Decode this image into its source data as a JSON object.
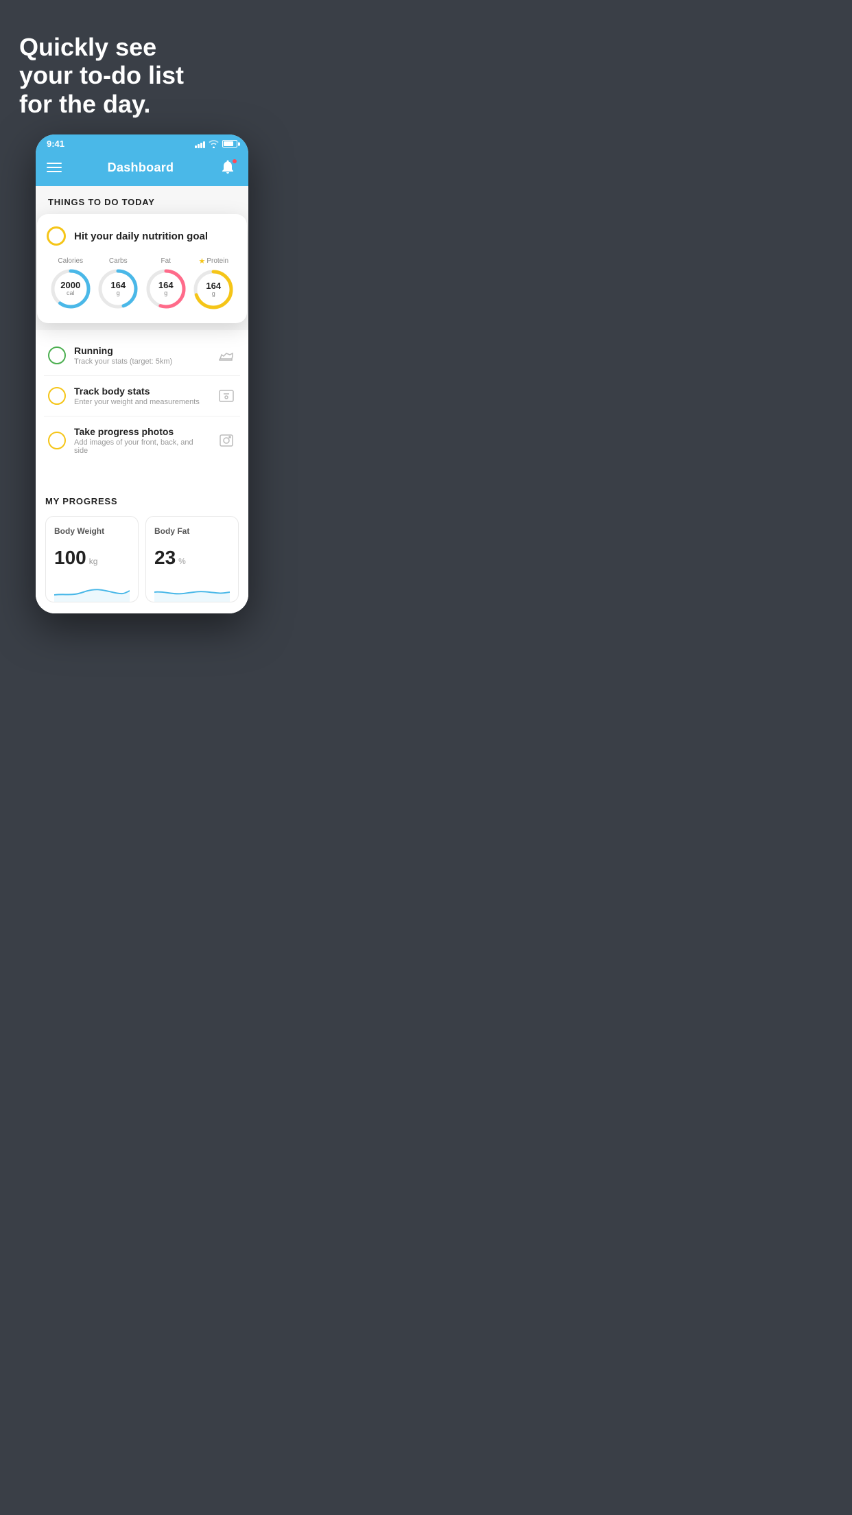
{
  "background": {
    "headline": "Quickly see\nyour to-do list\nfor the day."
  },
  "statusBar": {
    "time": "9:41"
  },
  "header": {
    "title": "Dashboard"
  },
  "thingsToday": {
    "sectionTitle": "THINGS TO DO TODAY"
  },
  "nutritionCard": {
    "title": "Hit your daily nutrition goal",
    "items": [
      {
        "label": "Calories",
        "value": "2000",
        "unit": "cal",
        "color": "#4ab8e8",
        "percent": 60
      },
      {
        "label": "Carbs",
        "value": "164",
        "unit": "g",
        "color": "#4ab8e8",
        "percent": 45
      },
      {
        "label": "Fat",
        "value": "164",
        "unit": "g",
        "color": "#ff6b8a",
        "percent": 55
      },
      {
        "label": "Protein",
        "value": "164",
        "unit": "g",
        "color": "#f5c518",
        "percent": 70,
        "starred": true
      }
    ]
  },
  "todoItems": [
    {
      "title": "Running",
      "subtitle": "Track your stats (target: 5km)",
      "circleColor": "green",
      "icon": "shoe-icon"
    },
    {
      "title": "Track body stats",
      "subtitle": "Enter your weight and measurements",
      "circleColor": "yellow",
      "icon": "scale-icon"
    },
    {
      "title": "Take progress photos",
      "subtitle": "Add images of your front, back, and side",
      "circleColor": "yellow",
      "icon": "photo-icon"
    }
  ],
  "progressSection": {
    "sectionTitle": "MY PROGRESS",
    "cards": [
      {
        "title": "Body Weight",
        "value": "100",
        "unit": "kg"
      },
      {
        "title": "Body Fat",
        "value": "23",
        "unit": "%"
      }
    ]
  }
}
